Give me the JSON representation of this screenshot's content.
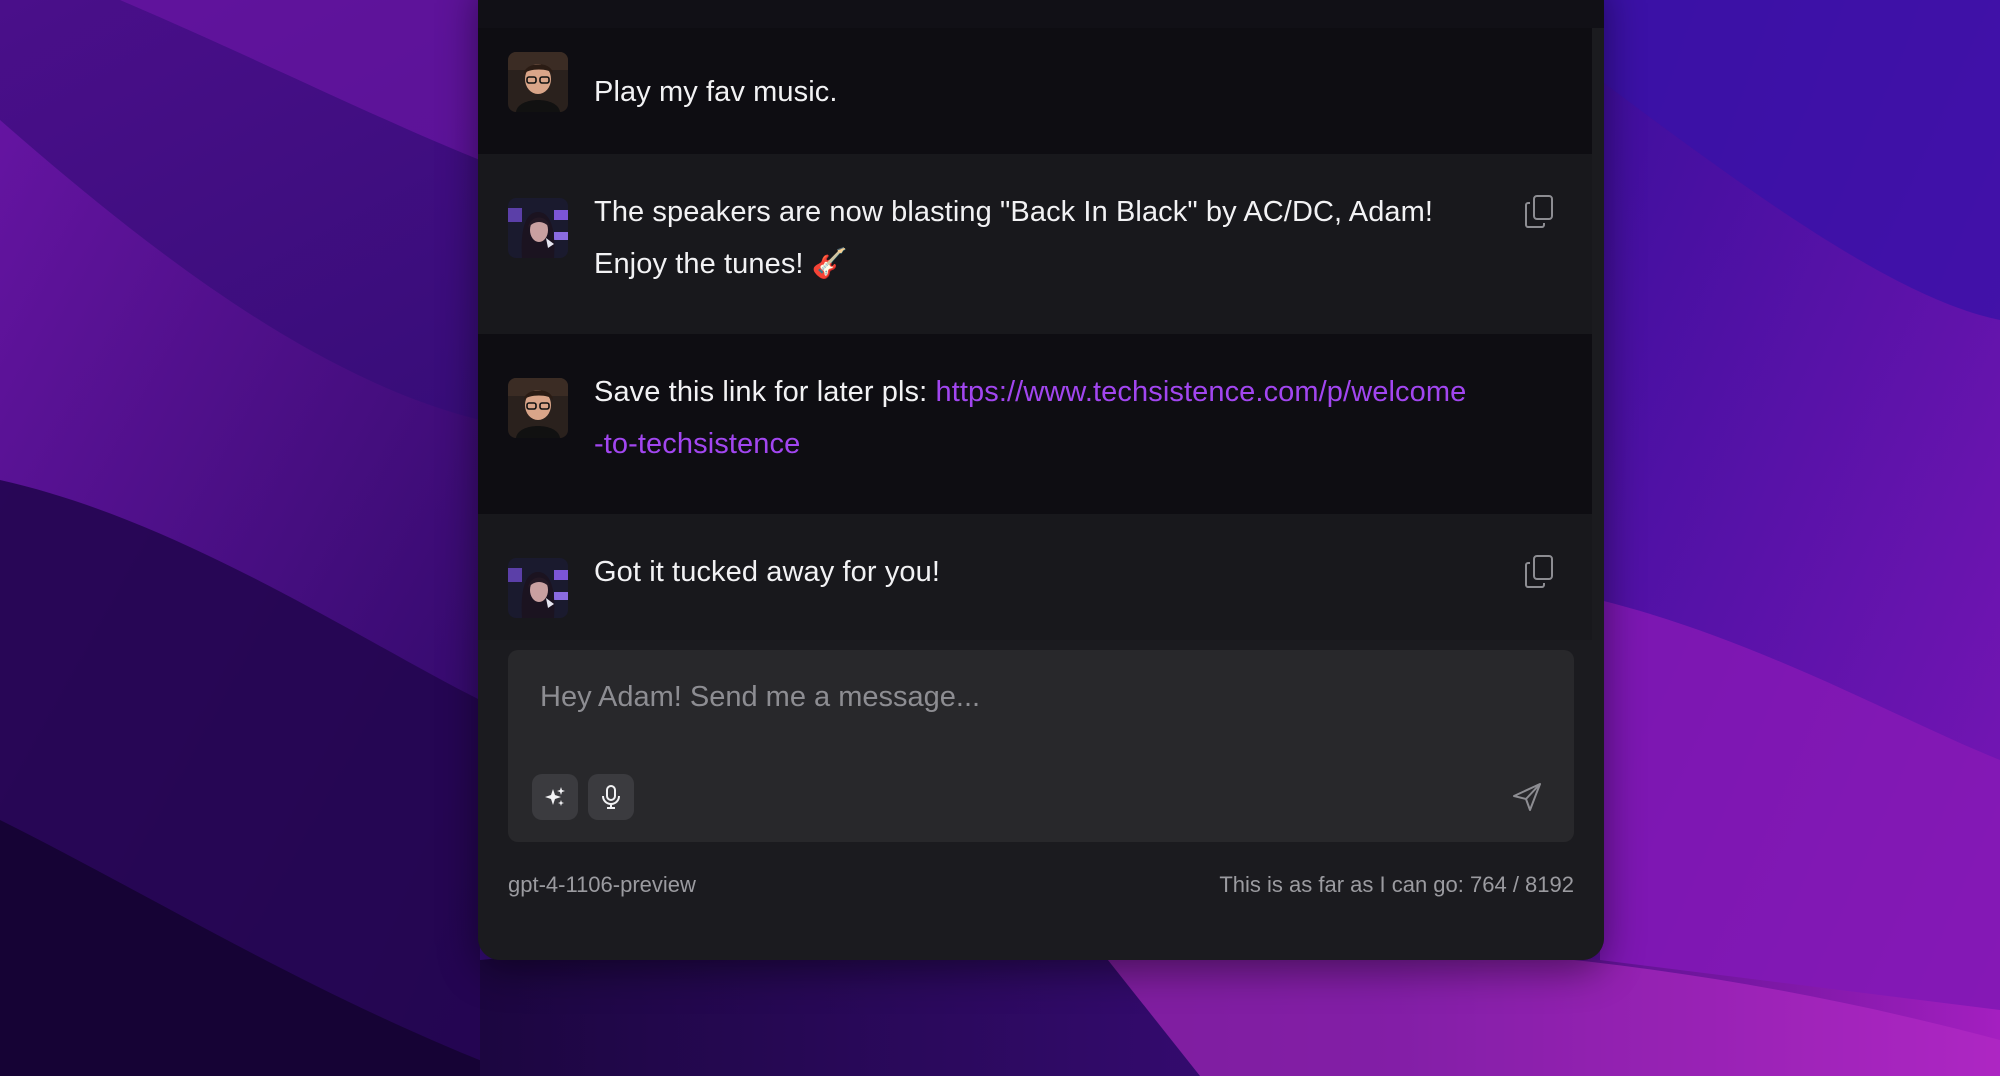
{
  "messages": [
    {
      "role": "user",
      "text": "Play my fav music."
    },
    {
      "role": "assistant",
      "text": "The speakers are now blasting \"Back In Black\" by AC/DC, Adam!",
      "text2": "Enjoy the tunes! 🎸"
    },
    {
      "role": "user",
      "text": "Save this link for later pls: ",
      "link": "https://www.techsistence.com/p/welcome",
      "link2": "-to-techsistence"
    },
    {
      "role": "assistant",
      "text": "Got it tucked away for you!"
    }
  ],
  "composer": {
    "placeholder": "Hey Adam! Send me a message...",
    "model": "gpt-4-1106-preview",
    "token_status": "This is as far as I can go: 764 / 8192"
  },
  "icons": {
    "copy": "copy-icon",
    "sparkle": "sparkle-icon",
    "microphone": "microphone-icon",
    "send": "send-icon"
  },
  "colors": {
    "link": "#a246f0",
    "window_bg": "#1b1b1f",
    "user_message_bg": "#0e0d12",
    "assistant_message_bg": "#18181c",
    "input_bg": "#28282b"
  }
}
